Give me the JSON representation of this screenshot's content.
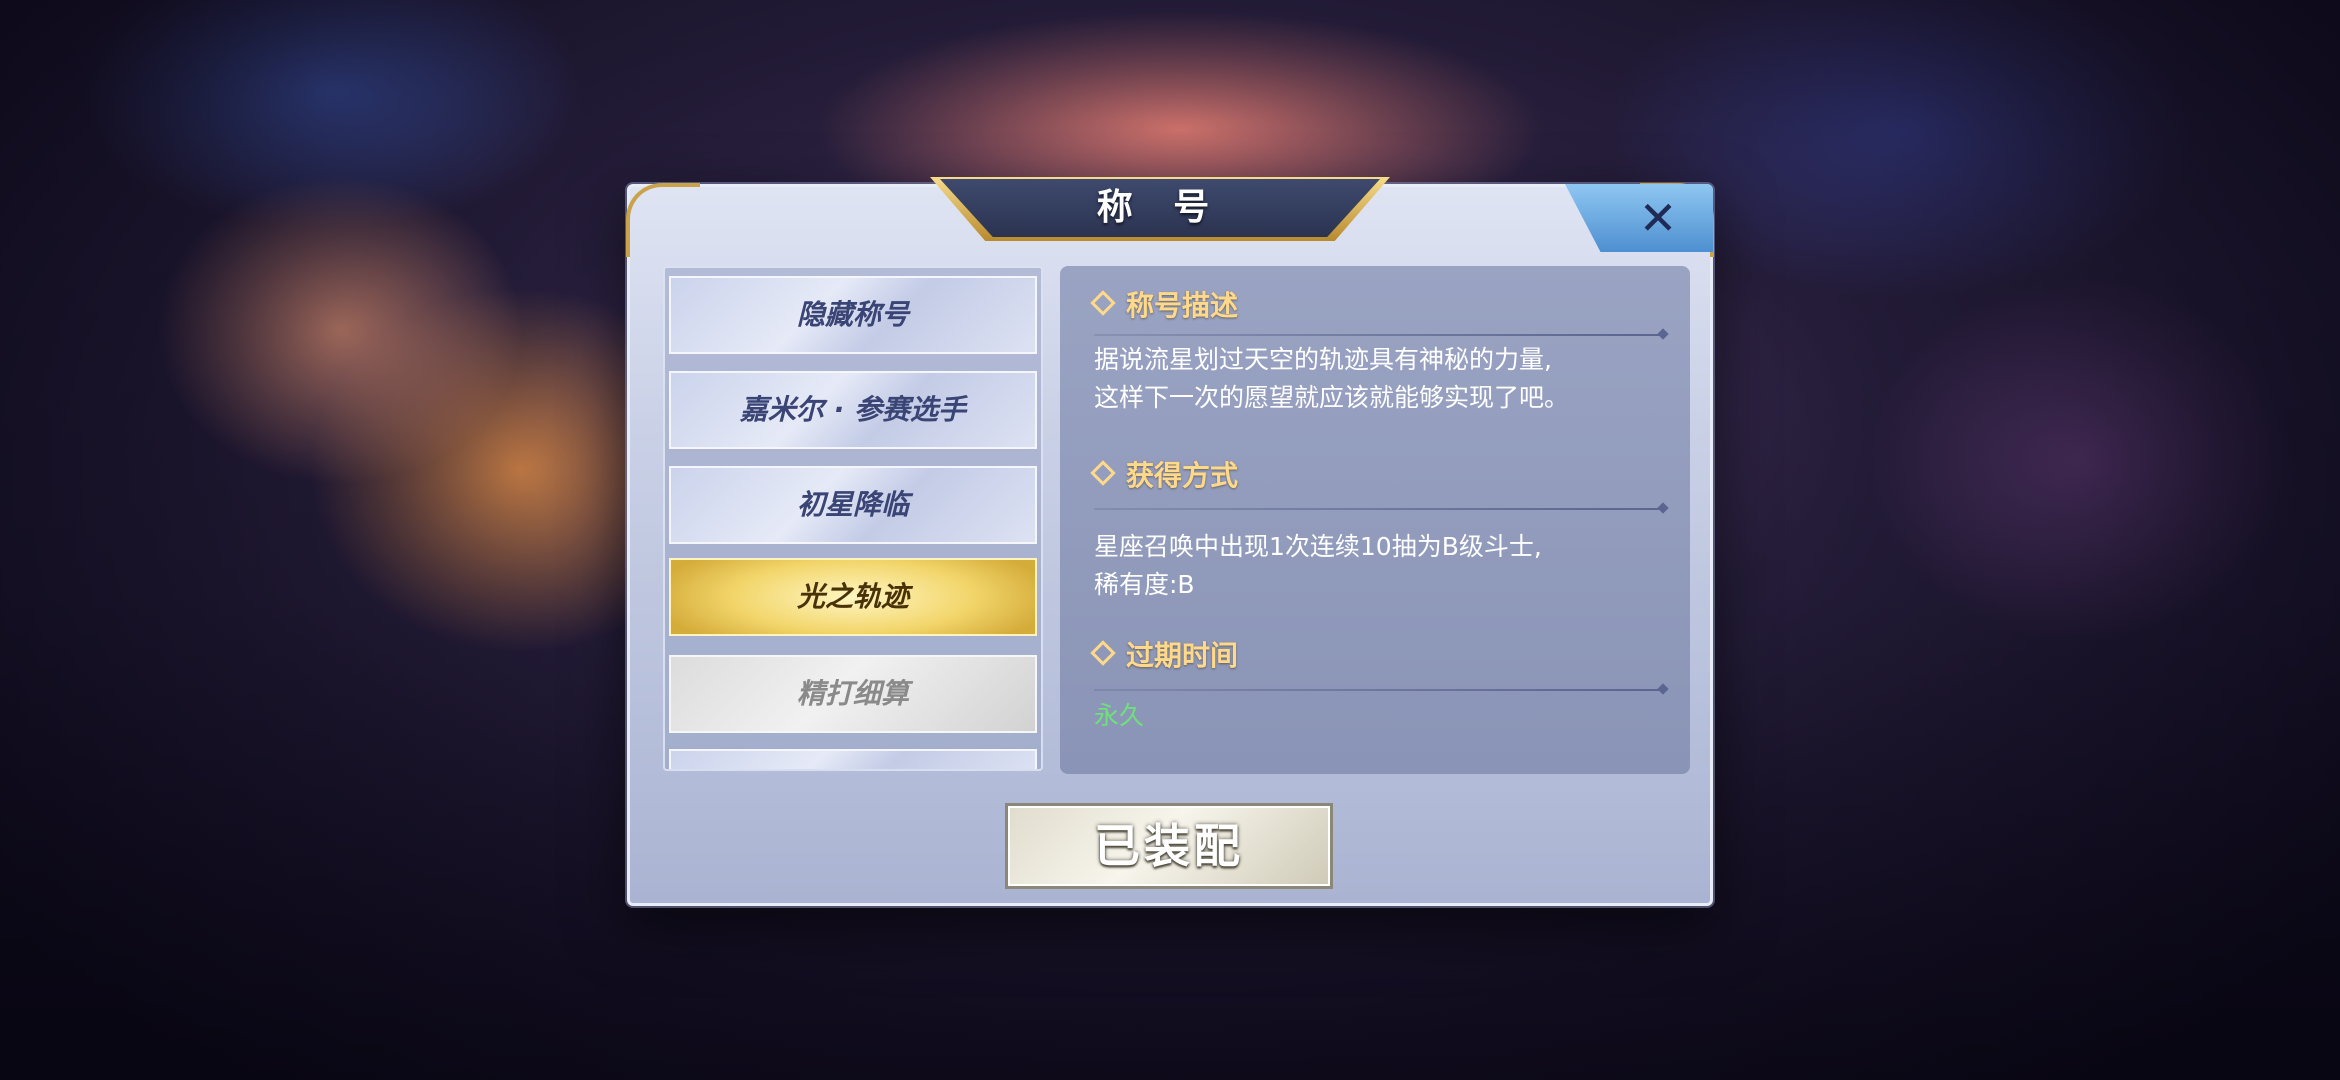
{
  "dialog": {
    "title": "称 号",
    "close_label": "✕"
  },
  "title_list": [
    {
      "label": "隐藏称号",
      "state": "normal"
    },
    {
      "label": "嘉米尔 · 参赛选手",
      "state": "normal"
    },
    {
      "label": "初星降临",
      "state": "normal"
    },
    {
      "label": "光之轨迹",
      "state": "selected"
    },
    {
      "label": "精打细算",
      "state": "locked"
    }
  ],
  "detail": {
    "description_heading": "称号描述",
    "description_line1": "据说流星划过天空的轨迹具有神秘的力量,",
    "description_line2": "这样下一次的愿望就应该就能够实现了吧。",
    "obtain_heading": "获得方式",
    "obtain_line1": "星座召唤中出现1次连续10抽为B级斗士,",
    "obtain_line2": "稀有度:B",
    "expire_heading": "过期时间",
    "expire_value": "永久"
  },
  "equip_button_label": "已装配",
  "colors": {
    "heading_gold": "#ffd98a",
    "expire_green": "#6fe07a",
    "selected_gold": "#f2d56a"
  }
}
